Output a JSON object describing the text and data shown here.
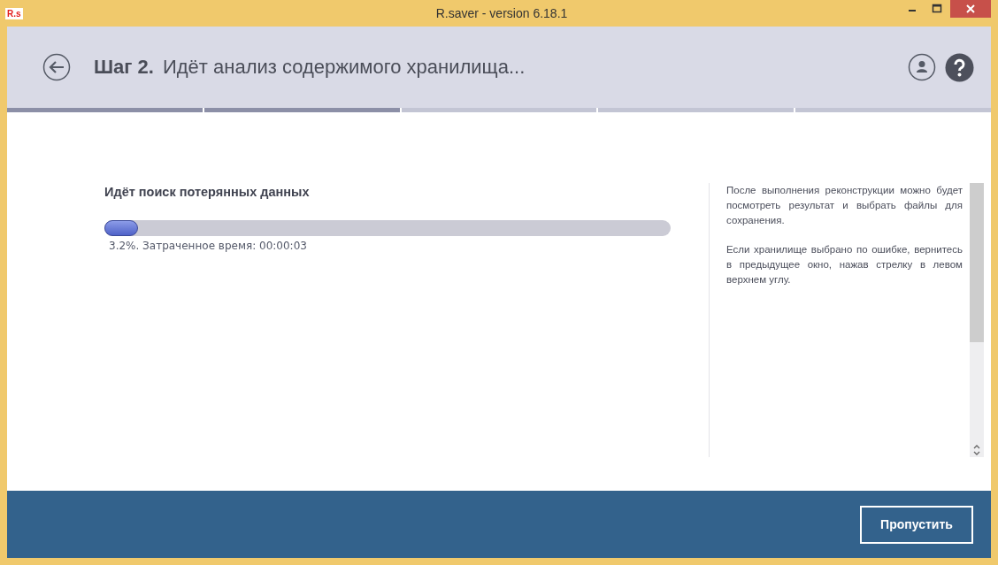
{
  "window": {
    "app_icon": "R.s",
    "title": "R.saver - version 6.18.1"
  },
  "header": {
    "step": "Шаг 2.",
    "title": "Идёт анализ содержимого хранилища..."
  },
  "steps": [
    {
      "done": true
    },
    {
      "done": true
    },
    {
      "done": false
    },
    {
      "done": false
    },
    {
      "done": false
    }
  ],
  "progress": {
    "heading": "Идёт поиск потерянных данных",
    "level": 0.032,
    "status": "3.2%. Затраченное время: 00:00:03"
  },
  "info": [
    "После выполнения реконструкции можно будет посмотреть результат и выбрать файлы для сохранения.",
    "Если хранилище выбрано по ошибке, вернитесь в предыдущее окно, нажав стрелку в левом верхнем углу."
  ],
  "footer": {
    "button": "Пропустить"
  }
}
